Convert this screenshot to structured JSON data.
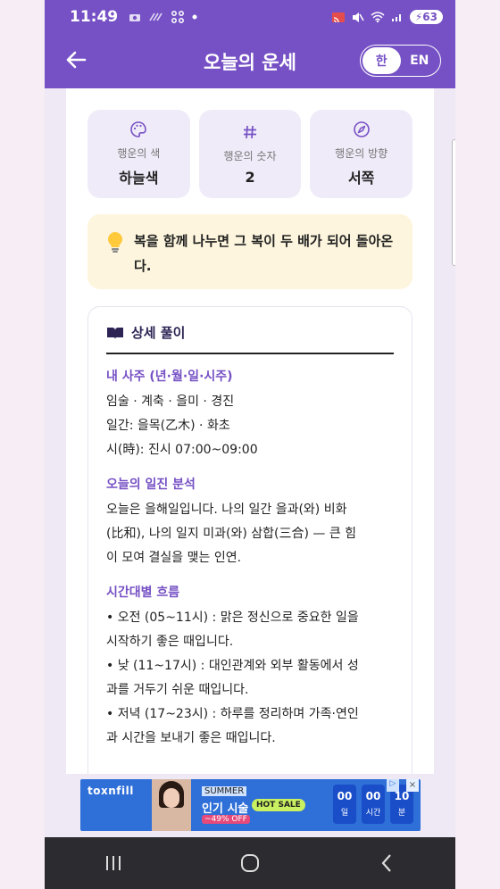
{
  "status_bar": {
    "time": "11:49",
    "battery": "63"
  },
  "app_bar": {
    "title": "오늘의 운세",
    "lang_ko": "한",
    "lang_en": "EN",
    "active_lang": "ko"
  },
  "lucky": [
    {
      "icon": "palette-icon",
      "label": "행운의 색",
      "value": "하늘색"
    },
    {
      "icon": "hash-icon",
      "label": "행운의 숫자",
      "value": "2"
    },
    {
      "icon": "compass-icon",
      "label": "행운의 방향",
      "value": "서쪽"
    }
  ],
  "tip": {
    "icon": "lightbulb-icon",
    "text": "복을 함께 나누면 그 복이 두 배가 되어 돌아온다."
  },
  "detail": {
    "header": "상세 풀이",
    "sections": [
      {
        "title": "내 사주 (년·월·일·시주)",
        "lines": [
          "임술 · 계축 · 을미 · 경진",
          "일간: 을목(乙木) · 화초",
          "시(時): 진시 07:00~09:00"
        ]
      },
      {
        "title": "오늘의 일진 분석",
        "lines": [
          "오늘은 을해일입니다. 나의 일간 을과(와) 비화",
          "(比和), 나의 일지 미과(와) 삼합(三合) — 큰 힘",
          "이 모여 결실을 맺는 인연."
        ]
      },
      {
        "title": "시간대별 흐름",
        "lines": [
          "• 오전 (05~11시) : 맑은 정신으로 중요한 일을",
          "시작하기 좋은 때입니다.",
          "• 낮 (11~17시) : 대인관계와 외부 활동에서 성",
          "과를 거두기 쉬운 때입니다.",
          "• 저녁 (17~23시) : 하루를 정리하며 가족·연인",
          "과 시간을 보내기 좋은 때입니다."
        ]
      }
    ]
  },
  "ad": {
    "brand": "toxnfill",
    "tag1": "SUMMER",
    "tag2": "인기 시술",
    "tag3": "~49% OFF",
    "sale": "HOT SALE",
    "timer": [
      {
        "value": "00",
        "unit": "일"
      },
      {
        "value": "00",
        "unit": "시간"
      },
      {
        "value": "10",
        "unit": "분"
      }
    ],
    "close": "×"
  },
  "colors": {
    "primary": "#7651c5",
    "card_bg": "#f0ebf8",
    "tip_bg": "#fdf5dd"
  }
}
